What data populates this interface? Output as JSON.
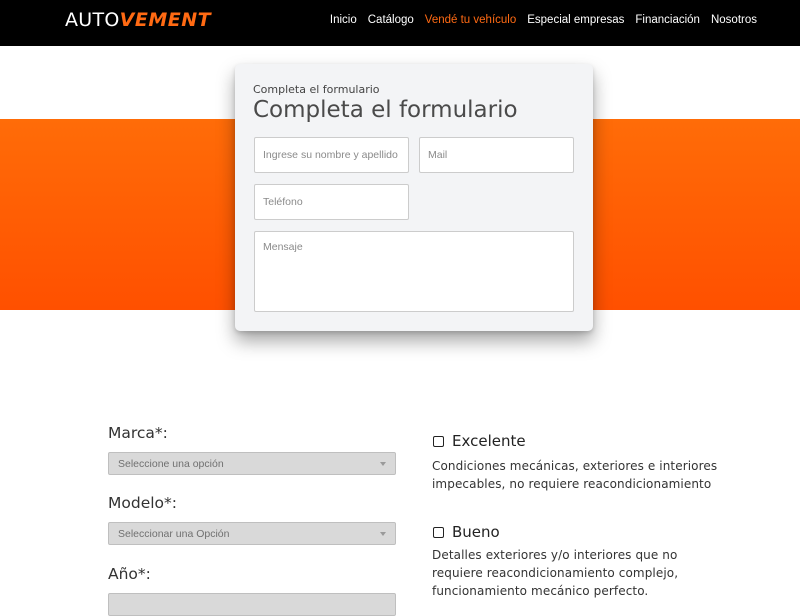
{
  "brand": {
    "logo_white": "AUTO",
    "logo_orange": "VEMENT"
  },
  "nav": {
    "items": [
      {
        "label": "Inicio"
      },
      {
        "label": "Catálogo"
      },
      {
        "label": "Vendé tu vehículo"
      },
      {
        "label": "Especial empresas"
      },
      {
        "label": "Financiación"
      },
      {
        "label": "Nosotros"
      }
    ],
    "active_index": 2
  },
  "form": {
    "small_heading": "Completa el formulario",
    "title": "Completa el formulario",
    "name_placeholder": "Ingrese su nombre y apellido",
    "mail_placeholder": "Mail",
    "phone_placeholder": "Teléfono",
    "message_placeholder": "Mensaje"
  },
  "vehicle": {
    "brand_label": "Marca*:",
    "brand_select": "Seleccione una opción",
    "model_label": "Modelo*:",
    "model_select": "Seleccionar una Opción",
    "year_label": "Año*:"
  },
  "condition": {
    "options": [
      {
        "title": "Excelente",
        "description": "Condiciones mecánicas, exteriores e interiores impecables, no requiere reacondicionamiento"
      },
      {
        "title": "Bueno",
        "description": "Detalles exteriores y/o interiores que no requiere reacondicionamiento complejo, funcionamiento mecánico perfecto."
      }
    ]
  },
  "colors": {
    "accent": "#ff6a13",
    "navbar": "#000000",
    "band_top": "#ff6c08",
    "band_bottom": "#ff5000"
  }
}
